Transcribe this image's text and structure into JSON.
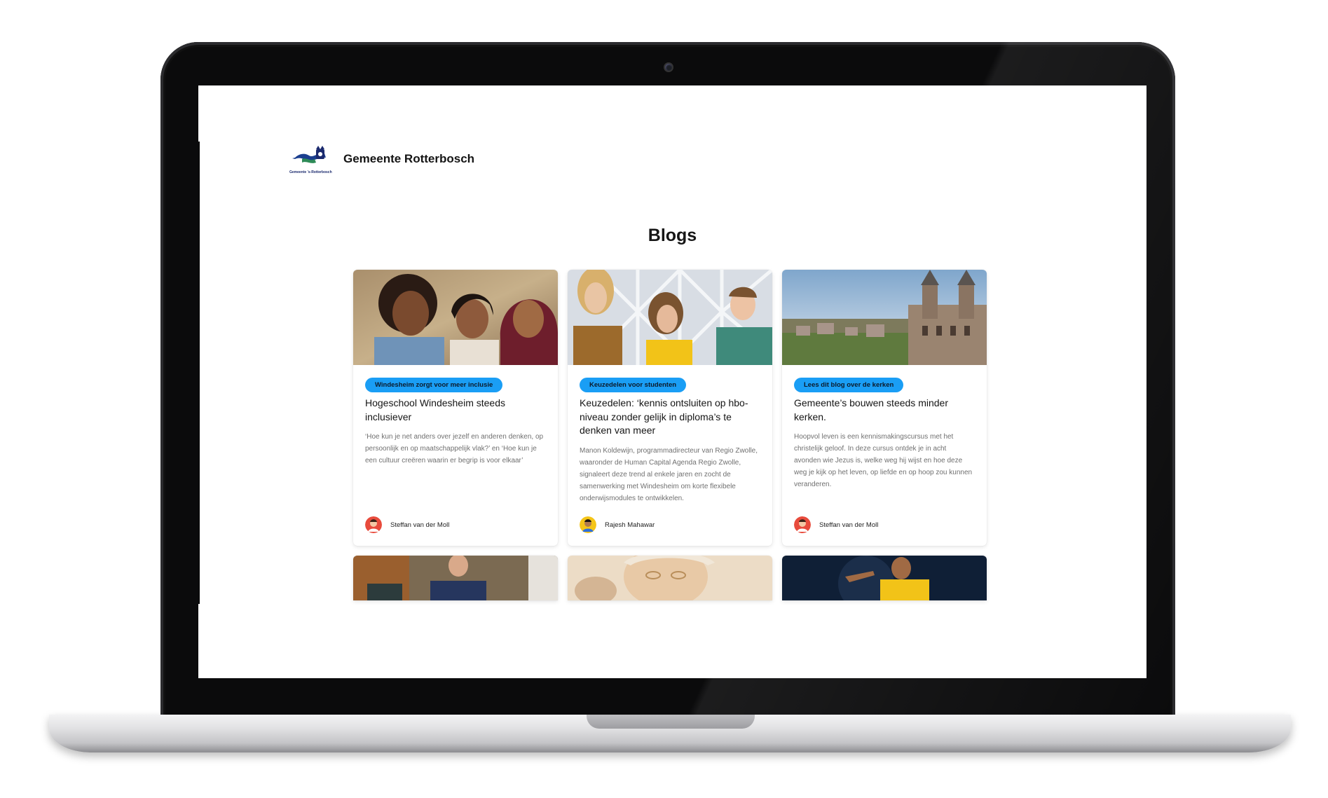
{
  "site": {
    "name": "Gemeente Rotterbosch",
    "logo_caption": "Gemeente 's-Rotterbosch"
  },
  "page": {
    "title": "Blogs"
  },
  "cards": [
    {
      "tag": "Windesheim zorgt voor meer inclusie",
      "title": "Hogeschool Windesheim steeds inclusiever",
      "excerpt": "‘Hoe kun je net anders over jezelf en anderen denken, op persoonlijk en op maatschappelijk vlak?’ en ‘Hoe kun je een cultuur creëren waarin er begrip is voor elkaar’",
      "author": "Steffan van der Moll",
      "image": "three-smiling-women-photo"
    },
    {
      "tag": "Keuzedelen voor studenten",
      "title": "Keuzedelen: ‘kennis ontsluiten op hbo-niveau zonder gelijk in diploma’s te denken van meer",
      "excerpt": "Manon Koldewijn, programmadirecteur van Regio Zwolle, waaronder de Human Capital Agenda Regio Zwolle, signaleert deze trend al enkele jaren en zocht de samenwerking met Windesheim om korte flexibele onderwijsmodules te ontwikkelen.",
      "author": "Rajesh Mahawar",
      "image": "three-students-photo"
    },
    {
      "tag": "Lees dit blog over de kerken",
      "title": "Gemeente’s bouwen steeds minder kerken.",
      "excerpt": "Hoopvol leven is een kennismakingscursus met het christelijk geloof. In deze cursus ontdek je in acht avonden wie Jezus is, welke weg hij wijst en hoe deze weg je kijk op het leven, op liefde en op hoop zou kunnen veranderen.",
      "author": "Steffan van der Moll",
      "image": "church-cityscape-photo"
    }
  ],
  "partial_cards": [
    {
      "image": "man-in-suit-photo"
    },
    {
      "image": "elderly-woman-photo"
    },
    {
      "image": "football-player-photo"
    }
  ],
  "colors": {
    "tag_background": "#1a9ef5",
    "bezel": "#0b0b0c"
  }
}
